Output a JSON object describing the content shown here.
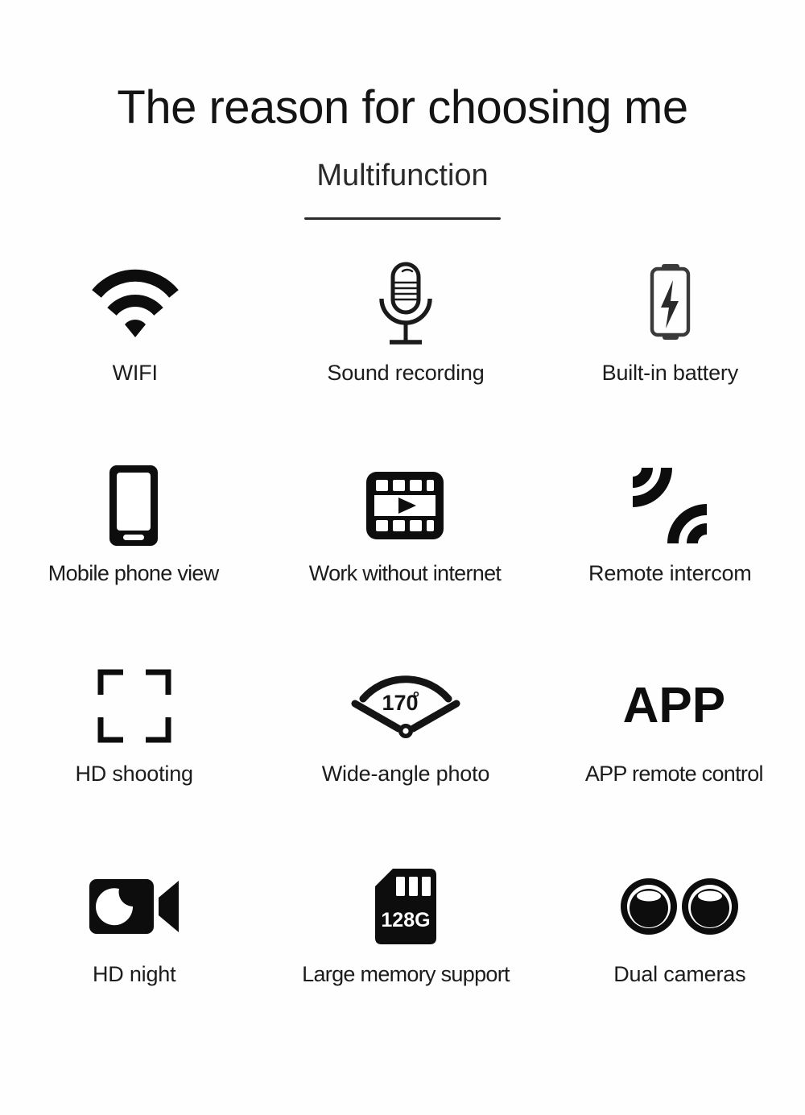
{
  "header": {
    "title": "The reason for choosing me",
    "subtitle": "Multifunction"
  },
  "features": [
    {
      "icon": "wifi-icon",
      "label": "WIFI"
    },
    {
      "icon": "microphone-icon",
      "label": "Sound recording"
    },
    {
      "icon": "battery-icon",
      "label": "Built-in battery"
    },
    {
      "icon": "mobile-phone-icon",
      "label": "Mobile phone view"
    },
    {
      "icon": "film-strip-play-icon",
      "label": "Work without internet"
    },
    {
      "icon": "intercom-waves-icon",
      "label": "Remote intercom"
    },
    {
      "icon": "focus-frame-icon",
      "label": "HD shooting"
    },
    {
      "icon": "wide-angle-icon",
      "label": "Wide-angle photo"
    },
    {
      "icon": "app-wordmark-icon",
      "label": "APP remote control"
    },
    {
      "icon": "night-camera-icon",
      "label": "HD night"
    },
    {
      "icon": "sd-card-icon",
      "label": "Large memory support"
    },
    {
      "icon": "dual-lens-icon",
      "label": "Dual cameras"
    }
  ],
  "icon_text": {
    "wide_angle_value": "170",
    "wide_angle_degree": "°",
    "app_wordmark": "APP",
    "sd_capacity": "128G"
  },
  "colors": {
    "background": "#fefefe",
    "ink": "#141414",
    "label": "#1c1c1c",
    "divider": "#2b2b2b"
  }
}
